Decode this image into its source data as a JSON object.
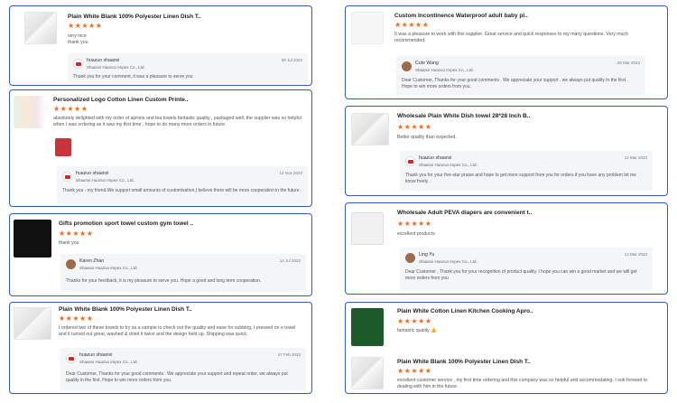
{
  "accent_color": "#2f5cc8",
  "star_color": "#f26b1d",
  "left": [
    {
      "title": "Plain White Blank 100% Polyester Linen Dish T..",
      "stars": "★★★★★",
      "review": "very nice\nthank you",
      "reply": {
        "seller": "huazuo shaanxi",
        "company": "Shaanxi Huazuo Impex Co., Ltd.",
        "date": "08 Jul 2022",
        "text": "Thank you for your comment, it was a pleasure to serve you"
      }
    },
    {
      "title": "Personalized Logo Cotton Linen Custom Printe..",
      "stars": "★★★★★",
      "review": "absolutely delighted with my order of aprons and tea towels fantastic quality , packaged well,  the supplier was so helpful when I was ordering as it was my first time , hope to do many more orders in future.",
      "reply": {
        "seller": "huazuo shaanxi",
        "company": "Shaanxi Huazuo Impex Co., Ltd.",
        "date": "13 Nov 2022",
        "text": "Thank you - my friend.We support small amounts of customisation,I believe there will be more cooperation in the future."
      }
    },
    {
      "title": "Gifts promotion sport towel custom gym towel  ..",
      "stars": "★★★★★",
      "review": "thank you",
      "reply": {
        "seller": "Karen Zhao",
        "company": "Shaanxi Huazuo Impex Co., Ltd.",
        "date": "14 Jul 2022",
        "text": "Thanks for your feedback, it is my pleasure to serve you. Hope a good and long term cooperation."
      }
    },
    {
      "title": "Plain White Blank 100% Polyester Linen Dish T..",
      "stars": "★★★★★",
      "review": "I ordered two of these towels to try as a sample to check out the quality and ease for subbing.  I pressed on e towel and it turned out great, washed & dried it twice and the design held up.  Shipping was quick.",
      "reply": {
        "seller": "huazuo shaanxi",
        "company": "Shaanxi Huazuo Impex Co., Ltd.",
        "date": "27 Feb 2023",
        "text": "Dear Customer, Thanks for your good comments . We appreciate your support and repeat order, we always put quality in the first. Hope to win more orders from you."
      }
    }
  ],
  "right": [
    {
      "title": "Custom Incontinence Waterproof adult baby pl..",
      "stars": "★★★★★",
      "review": "It was a pleasure to work with this supplier. Great service and quick responses to my many questions. Very much recommended.",
      "reply": {
        "seller": "Cute Wang",
        "company": "Shaanxi Huazuo Impex Co., Ltd.",
        "date": "09 Mar 2023",
        "text": "Dear Customer, Thanks for your good comments . We appreciate your support , we always put quality in the first .  Hope to win more orders from you."
      }
    },
    {
      "title": "Wholesale Plain White Dish towel 28*28 Inch B..",
      "stars": "★★★★★",
      "review": "Better quality than expected.",
      "reply": {
        "seller": "huazuo shaanxi",
        "company": "Shaanxi Huazuo Impex Co., Ltd.",
        "date": "12 Mar 2023",
        "text": "Thank you for your five-star praise and hope to get more support from you for orders.if you have any problem let me know freely ."
      }
    },
    {
      "title": "Wholesale Adult PEVA diapers are convenient t..",
      "stars": "★★★★★",
      "review": "excellent products",
      "reply": {
        "seller": "Ling Yu",
        "company": "Shaanxi Huazuo Impex Co., Ltd.",
        "date": "14 Mar 2023",
        "text": "Dear Customer , Thank you for your recognition of product quality. I hope you can win a good market and we will get more orders from you"
      }
    },
    {
      "title": "Plain White Cotton Linen Kitchen Cooking Apro..",
      "stars": "★★★★★",
      "review": "fantastic quality 👍"
    },
    {
      "title": "Plain White Blank 100% Polyester Linen Dish T..",
      "stars": "★★★★★",
      "review": "excellent customer service , my first time ordering and this company was so helpful and accommodating. I ook forward to dealing with him in the future."
    }
  ]
}
